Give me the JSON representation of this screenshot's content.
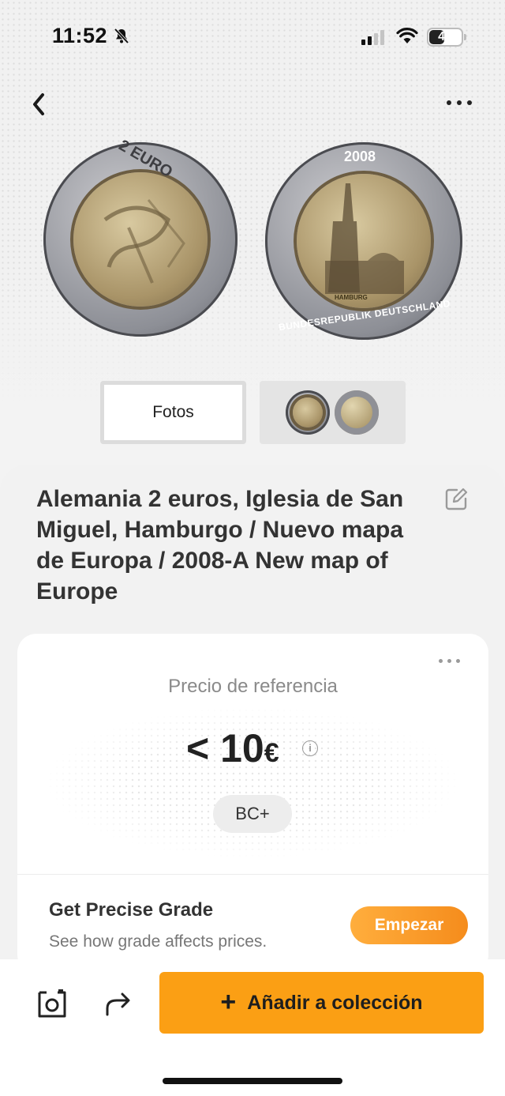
{
  "status_bar": {
    "time": "11:52",
    "battery": "44"
  },
  "header": {
    "back_icon": "chevron-left-icon",
    "more_icon": "ellipsis-icon"
  },
  "coin_images": {
    "obverse_text": "2 EURO",
    "reverse_year": "2008",
    "reverse_inscription": "BUNDESREPUBLIK DEUTSCHLAND",
    "reverse_city": "HAMBURG"
  },
  "tabs": {
    "photos_label": "Fotos"
  },
  "coin": {
    "title": "Alemania 2 euros, Iglesia de San Miguel, Hamburgo / Nuevo mapa de Europa / 2008-A New map of Europe"
  },
  "price_card": {
    "label": "Precio de referencia",
    "price_prefix": "< 10",
    "currency": "€",
    "grade": "BC+",
    "precise_title": "Get Precise Grade",
    "precise_subtitle": "See how grade affects prices.",
    "start_label": "Empezar"
  },
  "bottom": {
    "add_label": "Añadir a colección",
    "add_icon": "plus-icon"
  },
  "colors": {
    "accent": "#fb9f14",
    "button_gradient_start": "#ffae3d",
    "button_gradient_end": "#f58c1c"
  }
}
